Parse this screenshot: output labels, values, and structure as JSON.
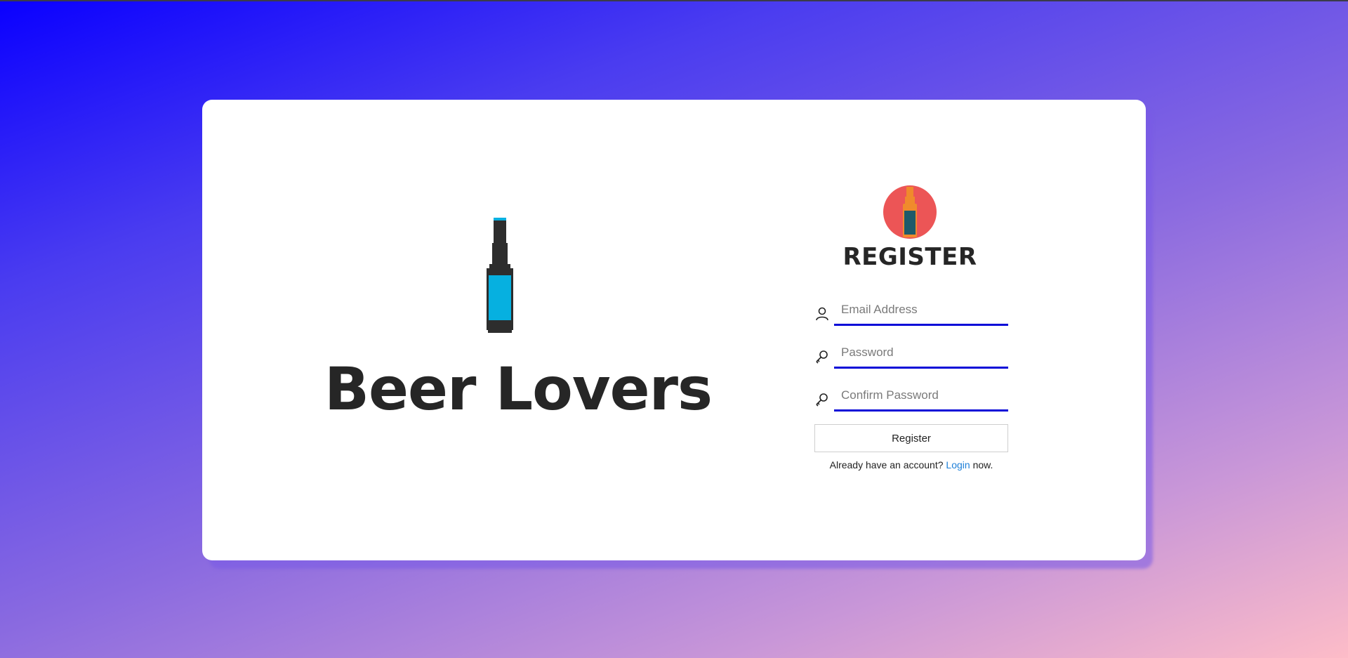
{
  "brand": {
    "title": "Beer Lovers",
    "illustration": "beer-bottle-icon"
  },
  "register": {
    "logo": "beer-bottle-logo-icon",
    "heading": "REGISTER",
    "email_placeholder": "Email Address",
    "email_icon": "user-icon",
    "password_placeholder": "Password",
    "password_icon": "key-icon",
    "confirm_placeholder": "Confirm Password",
    "confirm_icon": "key-icon",
    "submit_label": "Register",
    "login_prefix": "Already have an account?",
    "login_link": "Login",
    "login_suffix": "now."
  },
  "colors": {
    "input_underline": "#0a0ad8",
    "link": "#1d7fd8",
    "logo_circle": "#ec5556",
    "bottle_label": "#06b0e0"
  }
}
